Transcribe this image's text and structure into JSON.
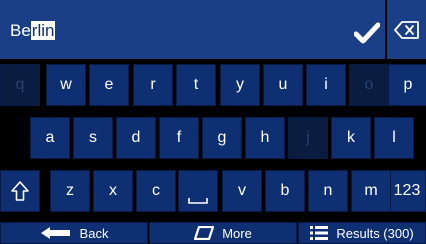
{
  "input": {
    "typed": "Be",
    "autocomplete": "rlin"
  },
  "icons": {
    "confirm": "checkmark-icon",
    "backspace": "backspace-icon",
    "shift": "shift-arrow-icon",
    "space": "space-bar-icon",
    "back": "arrow-left-icon",
    "more": "rounded-rectangle-icon",
    "results": "list-icon"
  },
  "keyboard": {
    "row1": [
      {
        "label": "q",
        "enabled": false
      },
      {
        "label": "w",
        "enabled": true
      },
      {
        "label": "e",
        "enabled": true
      },
      {
        "label": "r",
        "enabled": true
      },
      {
        "label": "t",
        "enabled": true
      },
      {
        "label": "y",
        "enabled": true
      },
      {
        "label": "u",
        "enabled": true
      },
      {
        "label": "i",
        "enabled": true
      },
      {
        "label": "o",
        "enabled": false
      },
      {
        "label": "p",
        "enabled": true
      }
    ],
    "row2": [
      {
        "label": "a",
        "enabled": true
      },
      {
        "label": "s",
        "enabled": true
      },
      {
        "label": "d",
        "enabled": true
      },
      {
        "label": "f",
        "enabled": true
      },
      {
        "label": "g",
        "enabled": true
      },
      {
        "label": "h",
        "enabled": true
      },
      {
        "label": "j",
        "enabled": false
      },
      {
        "label": "k",
        "enabled": true
      },
      {
        "label": "l",
        "enabled": true
      }
    ],
    "row3": [
      {
        "label": "z",
        "enabled": true
      },
      {
        "label": "x",
        "enabled": true
      },
      {
        "label": "c",
        "enabled": true
      },
      {
        "label": "v",
        "enabled": true
      },
      {
        "label": "b",
        "enabled": true
      },
      {
        "label": "n",
        "enabled": true
      },
      {
        "label": "m",
        "enabled": true
      }
    ],
    "numbers_label": "123"
  },
  "bottom_bar": {
    "back_label": "Back",
    "more_label": "More",
    "results_label": "Results (300)"
  },
  "colors": {
    "key": "#0e2f72",
    "key_disabled": "#0a1c40",
    "input_bar": "#1a3f86",
    "text": "#ffffff"
  }
}
